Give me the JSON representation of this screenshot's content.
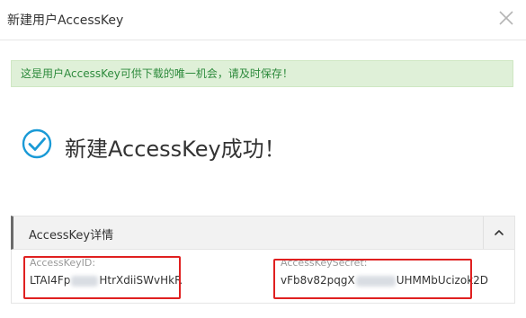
{
  "dialog": {
    "title": "新建用户AccessKey",
    "close_icon": "close-icon"
  },
  "notice": {
    "text": "这是用户AccessKey可供下载的唯一机会，请及时保存！"
  },
  "success": {
    "icon": "check-circle-icon",
    "message": "新建AccessKey成功！"
  },
  "details": {
    "title": "AccessKey详情",
    "toggle_icon": "chevron-up-icon",
    "id": {
      "label": "AccessKeyID:",
      "value_prefix": "LTAI4Fp",
      "value_suffix": "HtrXdiiSWvHkR"
    },
    "secret": {
      "label": "AccessKeySecret:",
      "value_prefix": "vFb8v82pqgX",
      "value_suffix": "UHMMbUcizok2D"
    }
  },
  "colors": {
    "notice_bg": "#dff0d8",
    "notice_text": "#2d8a3c",
    "success_icon": "#1a9ad6",
    "highlight": "#e02020"
  }
}
